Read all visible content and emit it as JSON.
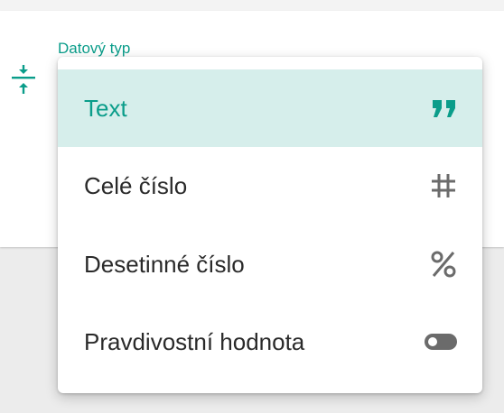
{
  "field": {
    "label": "Datový typ"
  },
  "menu": {
    "items": [
      {
        "label": "Text",
        "icon": "quote-icon",
        "selected": true
      },
      {
        "label": "Celé číslo",
        "icon": "hash-icon",
        "selected": false
      },
      {
        "label": "Desetinné číslo",
        "icon": "percent-icon",
        "selected": false
      },
      {
        "label": "Pravdivostní hodnota",
        "icon": "toggle-icon",
        "selected": false
      }
    ]
  },
  "colors": {
    "accent": "#0a9d8a",
    "selected_bg": "#d6eeeb",
    "icon_gray": "#6b6b6b",
    "text": "#2a2a2a"
  }
}
